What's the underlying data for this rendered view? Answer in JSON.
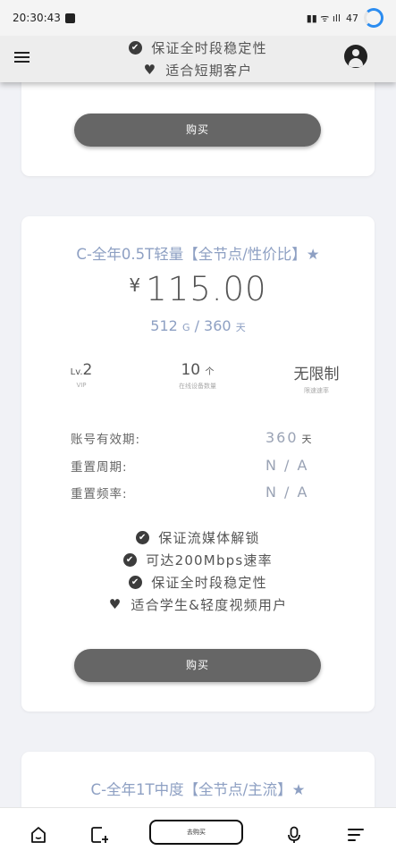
{
  "status_bar": {
    "time": "20:30:43",
    "battery": "47"
  },
  "header": {
    "menu_icon": "menu-icon",
    "account_icon": "account-circle-icon"
  },
  "card_top": {
    "features": [
      {
        "icon": "check-circle-icon",
        "text": "保证全时段稳定性"
      },
      {
        "icon": "heart-icon",
        "text": "适合短期客户"
      }
    ],
    "buy_label": "购买"
  },
  "card_main": {
    "title": "C-全年0.5T轻量【全节点/性价比】★",
    "currency": "¥",
    "price": "115.00",
    "traffic": "512",
    "traffic_unit": "G",
    "separator": "/",
    "days": "360",
    "days_unit": "天",
    "stats": [
      {
        "prefix": "Lv.",
        "value": "2",
        "suffix": "",
        "label": "VIP"
      },
      {
        "prefix": "",
        "value": "10",
        "suffix": "个",
        "label": "在线设备数量"
      },
      {
        "prefix": "",
        "value": "无限制",
        "suffix": "",
        "label": "限速速率"
      }
    ],
    "info": [
      {
        "key": "账号有效期:",
        "value": "360",
        "unit": "天"
      },
      {
        "key": "重置周期:",
        "value": "N / A",
        "unit": ""
      },
      {
        "key": "重置频率:",
        "value": "N / A",
        "unit": ""
      }
    ],
    "features": [
      {
        "icon": "check-circle-icon",
        "text": "保证流媒体解锁"
      },
      {
        "icon": "check-circle-icon",
        "text": "可达200Mbps速率"
      },
      {
        "icon": "check-circle-icon",
        "text": "保证全时段稳定性"
      },
      {
        "icon": "heart-icon",
        "text": "适合学生&轻度视频用户"
      }
    ],
    "buy_label": "购买"
  },
  "card_next": {
    "title": "C-全年1T中度【全节点/主流】★"
  },
  "bottom_nav": {
    "pill_label": "去购买",
    "icons": [
      "home-icon",
      "tabs-icon",
      "mic-icon",
      "menu-lines-icon"
    ]
  }
}
